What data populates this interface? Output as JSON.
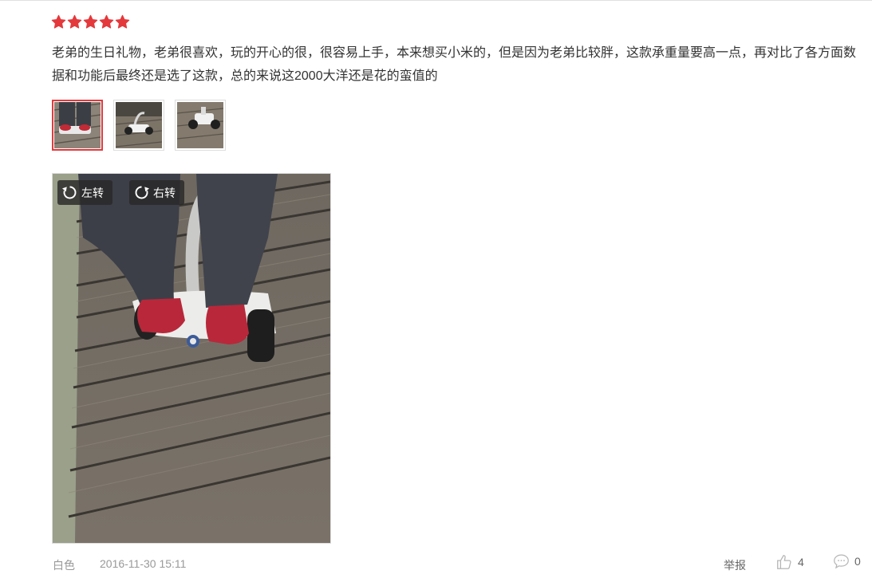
{
  "review": {
    "rating": 5,
    "text": "老弟的生日礼物，老弟很喜欢，玩的开心的很，很容易上手，本来想买小米的，但是因为老弟比较胖，这款承重量要高一点，再对比了各方面数据和功能后最终还是选了这款，总的来说这2000大洋还是花的蛮值的",
    "thumbnails": [
      {
        "icon": "photo-legs-on-scooter"
      },
      {
        "icon": "photo-scooter-on-deck"
      },
      {
        "icon": "photo-scooter-side"
      }
    ],
    "viewer": {
      "rotate_left": "左转",
      "rotate_right": "右转"
    },
    "meta": {
      "color": "白色",
      "datetime": "2016-11-30 15:11"
    },
    "actions": {
      "report": "举报",
      "likes": "4",
      "replies": "0"
    }
  },
  "colors": {
    "star": "#e4393c",
    "active_border": "#e4393c",
    "meta_text": "#999999"
  }
}
